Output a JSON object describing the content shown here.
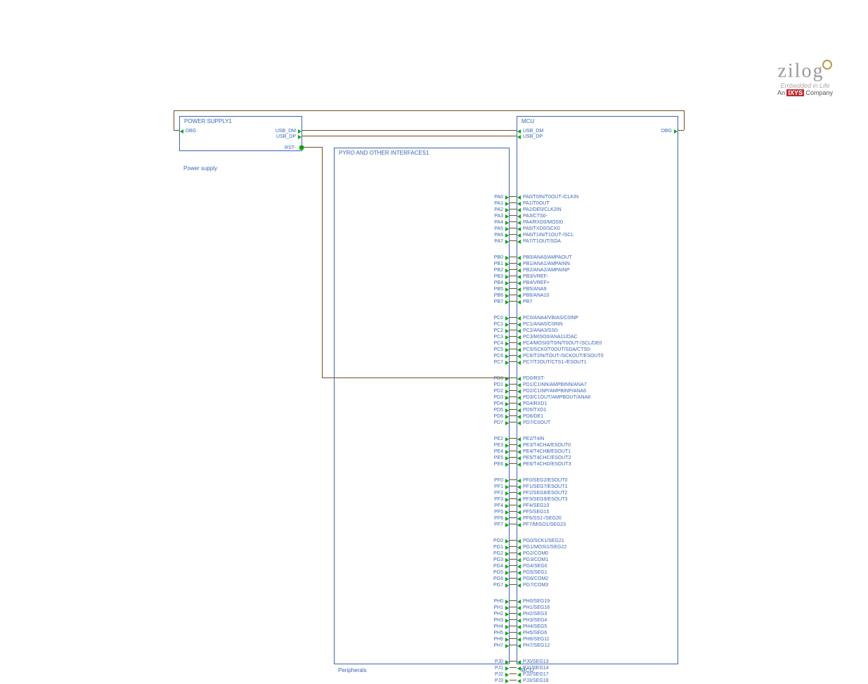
{
  "logo": {
    "brand": "zilog",
    "tag1": "Embedded in Life",
    "tag2_prefix": "An ",
    "tag2_ixys": "IXYS",
    "tag2_suffix": " Company"
  },
  "blocks": {
    "power": {
      "title": "POWER SUPPLY1",
      "sub": "Power supply"
    },
    "pyro": {
      "title": "PYRO AND OTHER INTERFACES1",
      "sub": "Peripherals"
    },
    "mcu": {
      "title": "MCU",
      "sub": "MCU"
    }
  },
  "ps_pins": {
    "dbg_left": "DBG",
    "usb_dm": "USB_DM",
    "usb_dp": "USB_DP",
    "rst": "RST-"
  },
  "mcu_top": {
    "usb_dm": "USB_DM",
    "usb_dp": "USB_DP",
    "dbg_right": "DBG"
  },
  "ports": {
    "PA": {
      "left": [
        "PA0",
        "PA1",
        "PA2",
        "PA3",
        "PA4",
        "PA5",
        "PA6",
        "PA7"
      ],
      "right": [
        "PA0/T0IN/T0OUT-/CLKIN",
        "PA1/T0OUT",
        "PA2/DE0/CLK2IN",
        "PA3/CTS0-",
        "PA4/RXD0/MOSI0",
        "PA5/TXD0/SCK0",
        "PA6/T1IN/T1OUT-/SCL",
        "PA7/T1OUT/SDA"
      ]
    },
    "PB": {
      "left": [
        "PB0",
        "PB1",
        "PB2",
        "PB3",
        "PB4",
        "PB5",
        "PB6",
        "PB7"
      ],
      "right": [
        "PB0/ANA0/AMPAOUT",
        "PB1/ANA1/AMPAINN",
        "PB2/ANA2/AMPAINP",
        "PB3/VREF-",
        "PB4/VREF+",
        "PB5/ANA9",
        "PB6/ANA10",
        "PB7"
      ]
    },
    "PC": {
      "left": [
        "PC0",
        "PC1",
        "PC2",
        "PC3",
        "PC4",
        "PC5",
        "PC6",
        "PC7"
      ],
      "right": [
        "PC0/ANA4/VBIAS/C0INP",
        "PC1/ANA5/C0INN",
        "PC2/ANA3/SS0-",
        "PC3/MISO0/ANA11/DAC",
        "PC4/MOSI0/T0IN/T0OUT-/SCL/DE0",
        "PC5/SCK0/T0OUT/SDA/CTS0-",
        "PC6/T2IN/TOUT-/SCKOUT/ESOUT0",
        "PC7/T2OUT/CTS1-/ESOUT1"
      ]
    },
    "PD": {
      "left": [
        "PD0",
        "PD1",
        "PD2",
        "PD3",
        "PD4",
        "PD5",
        "PD6",
        "PD7"
      ],
      "right": [
        "PD0/RST-",
        "PD1/C1INN/AMPBINN/ANA7",
        "PD2/C1INP/AMPBINP/ANA6",
        "PD3/C1OUT/AMPBOUT/ANA8",
        "PD4/RXD1",
        "PD5/TXD1",
        "PD6/DE1",
        "PD7/C0OUT"
      ]
    },
    "PE": {
      "left": [
        "PE2",
        "PE3",
        "PE4",
        "PE5",
        "PE6"
      ],
      "right": [
        "PE2/T4IN",
        "PE3/T4CHA/ESOUT0",
        "PE4/T4CHB/ESOUT1",
        "PE5/T4CHC/ESOUT2",
        "PE6/T4CHD/ESOUT3"
      ]
    },
    "PF": {
      "left": [
        "PF0",
        "PF1",
        "PF2",
        "PF3",
        "PF4",
        "PF5",
        "PF6",
        "PF7"
      ],
      "right": [
        "PF0/SEG2/ESOUT0",
        "PF1/SEG7/ESOUT1",
        "PF2/SEG8/ESOUT2",
        "PF3/SEG9/ESOUT3",
        "PF4/SEG10",
        "PF5/SEG15",
        "PF6/SS1-/SEG20",
        "PF7/MISO1/SEG23"
      ]
    },
    "PG": {
      "left": [
        "PG0",
        "PG1",
        "PG2",
        "PG3",
        "PG4",
        "PG5",
        "PG6",
        "PG7"
      ],
      "right": [
        "PG0/SCK1/SEG21",
        "PG1/MOSI1/SEG22",
        "PG2/COM0",
        "PG3/COM1",
        "PG4/SEG0",
        "PG5/SEG1",
        "PG6/COM2",
        "PG7/COM3"
      ]
    },
    "PH": {
      "left": [
        "PH0",
        "PH1",
        "PH2",
        "PH3",
        "PH4",
        "PH5",
        "PH6",
        "PH7"
      ],
      "right": [
        "PH0/SEG19",
        "PH1/SEG16",
        "PH2/SEG3",
        "PH3/SEG4",
        "PH4/SEG5",
        "PH5/SEG6",
        "PH6/SEG11",
        "PH7/SEG12"
      ]
    },
    "PJ": {
      "left": [
        "PJ0",
        "PJ1",
        "PJ2",
        "PJ3"
      ],
      "right": [
        "PJ0/SEG13",
        "PJ1/SEG14",
        "PJ2/SEG17",
        "PJ3/SEG18"
      ]
    }
  },
  "port_order": [
    "PA",
    "PB",
    "PC",
    "PD",
    "PE",
    "PF",
    "PG",
    "PH",
    "PJ"
  ]
}
